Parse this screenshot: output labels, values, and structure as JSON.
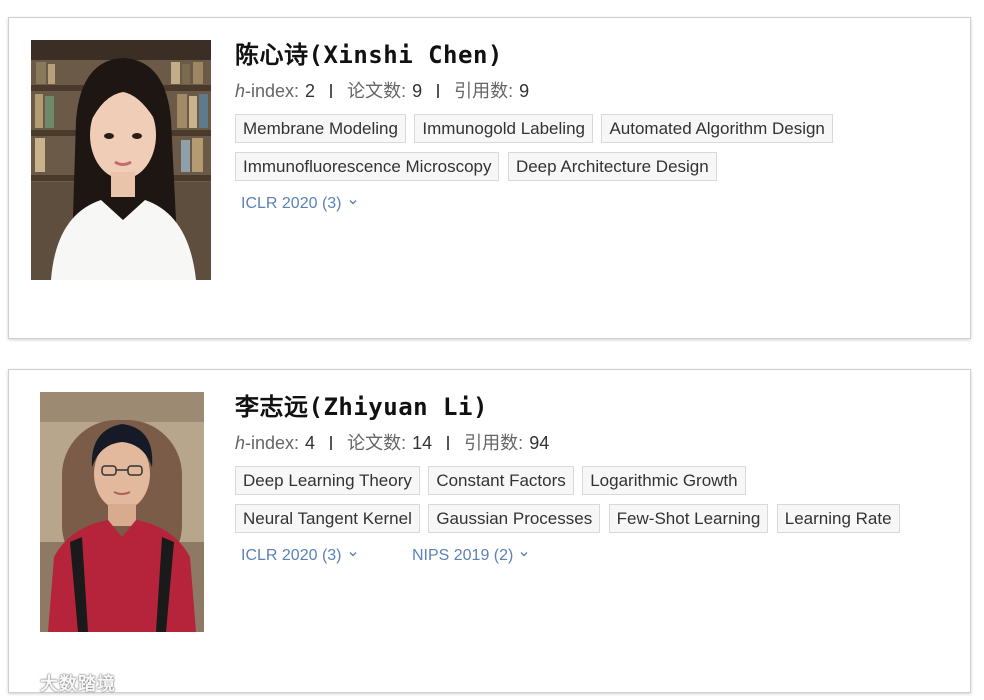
{
  "researchers": [
    {
      "name": "陈心诗(Xinshi Chen)",
      "stats": {
        "h_prefix": "h",
        "h_label": "-index:",
        "h_index": "2",
        "papers_label": "论文数:",
        "papers": "9",
        "citations_label": "引用数:",
        "citations": "9"
      },
      "tags": [
        "Membrane Modeling",
        "Immunogold Labeling",
        "Automated Algorithm Design",
        "Immunofluorescence Microscopy",
        "Deep Architecture Design"
      ],
      "venues": [
        "ICLR 2020 (3)"
      ]
    },
    {
      "name": "李志远(Zhiyuan Li)",
      "stats": {
        "h_prefix": "h",
        "h_label": "-index:",
        "h_index": "4",
        "papers_label": "论文数:",
        "papers": "14",
        "citations_label": "引用数:",
        "citations": "94"
      },
      "tags": [
        "Deep Learning Theory",
        "Constant Factors",
        "Logarithmic Growth",
        "Neural Tangent Kernel",
        "Gaussian Processes",
        "Few-Shot Learning",
        "Learning Rate"
      ],
      "venues": [
        "ICLR 2020 (3)",
        "NIPS 2019 (2)"
      ]
    }
  ],
  "watermark": "大数踏境",
  "colors": {
    "link": "#5b82b8",
    "tag_bg": "#f7f7f7",
    "tag_border": "#d9d9d9"
  }
}
